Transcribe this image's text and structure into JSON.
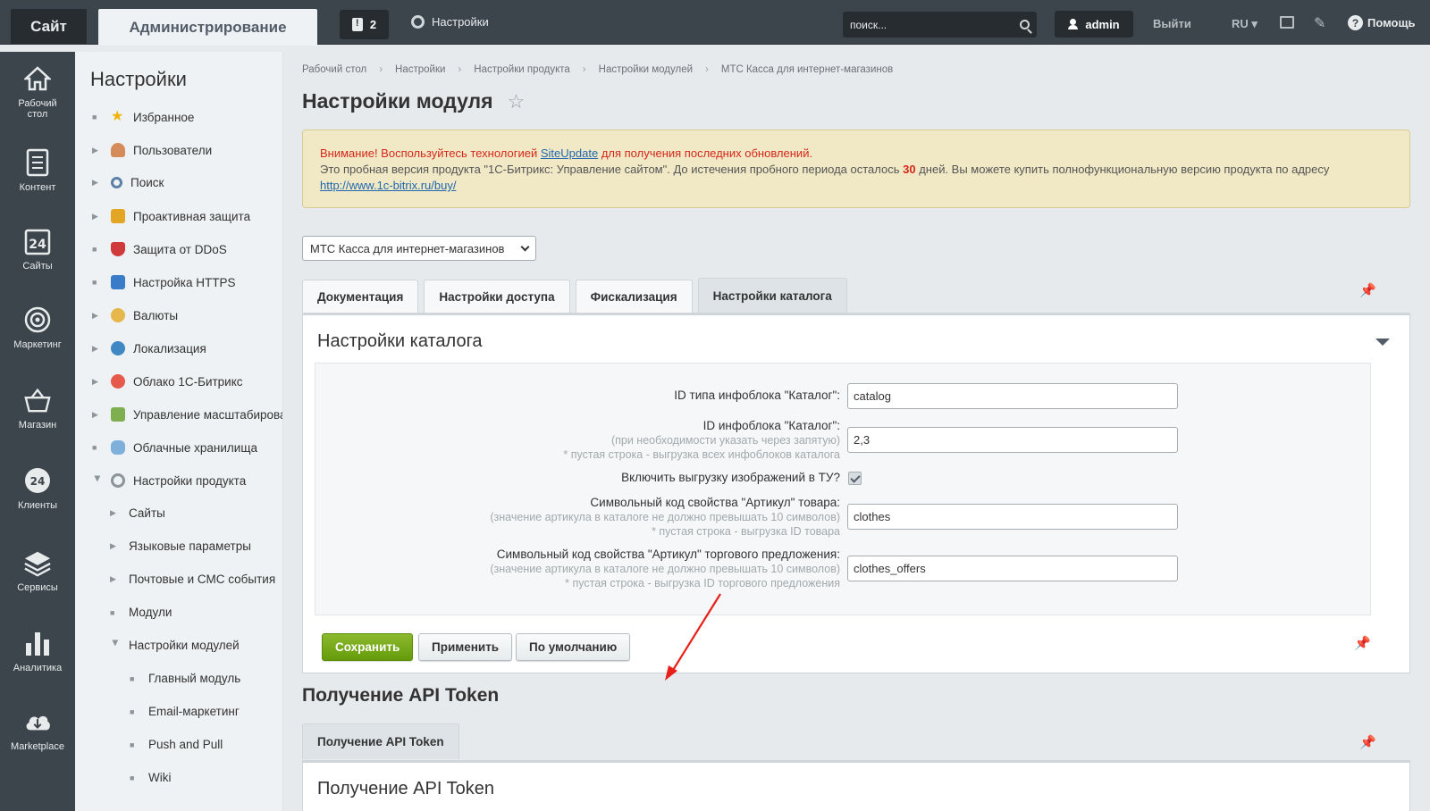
{
  "topbar": {
    "site_tab": "Сайт",
    "admin_tab": "Администрирование",
    "notifications_count": "2",
    "settings_label": "Настройки",
    "search_placeholder": "поиск...",
    "user": "admin",
    "logout": "Выйти",
    "lang": "RU",
    "help": "Помощь"
  },
  "leftmenu": {
    "items": [
      {
        "label": "Рабочий стол",
        "icon": "home-icon"
      },
      {
        "label": "Контент",
        "icon": "document-icon"
      },
      {
        "label": "Сайты",
        "icon": "calendar-24-icon"
      },
      {
        "label": "Маркетинг",
        "icon": "target-icon"
      },
      {
        "label": "Магазин",
        "icon": "basket-icon"
      },
      {
        "label": "Клиенты",
        "icon": "clients-24-icon"
      },
      {
        "label": "Сервисы",
        "icon": "layers-icon"
      },
      {
        "label": "Аналитика",
        "icon": "chart-icon"
      },
      {
        "label": "Marketplace",
        "icon": "cloud-download-icon"
      }
    ]
  },
  "sidebar": {
    "title": "Настройки",
    "items": [
      {
        "label": "Избранное"
      },
      {
        "label": "Пользователи"
      },
      {
        "label": "Поиск"
      },
      {
        "label": "Проактивная защита"
      },
      {
        "label": "Защита от DDoS"
      },
      {
        "label": "Настройка HTTPS"
      },
      {
        "label": "Валюты"
      },
      {
        "label": "Локализация"
      },
      {
        "label": "Облако 1С-Битрикс"
      },
      {
        "label": "Управление масштабирова"
      },
      {
        "label": "Облачные хранилища"
      },
      {
        "label": "Настройки продукта"
      },
      {
        "label": "Сайты"
      },
      {
        "label": "Языковые параметры"
      },
      {
        "label": "Почтовые и СМС события"
      },
      {
        "label": "Модули"
      },
      {
        "label": "Настройки модулей"
      },
      {
        "label": "Главный модуль"
      },
      {
        "label": "Email-маркетинг"
      },
      {
        "label": "Push and Pull"
      },
      {
        "label": "Wiki"
      }
    ]
  },
  "breadcrumbs": [
    "Рабочий стол",
    "Настройки",
    "Настройки продукта",
    "Настройки модулей",
    "МТС Касса для интернет-магазинов"
  ],
  "page_title": "Настройки модуля",
  "warning": {
    "line1_prefix": "Внимание! Воспользуйтесь технологией ",
    "line1_link": "SiteUpdate",
    "line1_suffix": " для получения последних обновлений.",
    "line2_prefix": "Это пробная версия продукта \"1С-Битрикс: Управление сайтом\". До истечения пробного периода осталось ",
    "days": "30",
    "line2_suffix": " дней. Вы можете купить полнофункциональную версию продукта по адресу ",
    "buy_link": "http://www.1c-bitrix.ru/buy/"
  },
  "module_select": "МТС Касса для интернет-магазинов",
  "tabs": [
    "Документация",
    "Настройки доступа",
    "Фискализация",
    "Настройки каталога"
  ],
  "active_tab": "Настройки каталога",
  "panel_title": "Настройки каталога",
  "form": {
    "iblock_type_label": "ID типа инфоблока \"Каталог\":",
    "iblock_type_value": "catalog",
    "iblock_id_label": "ID инфоблока \"Каталог\":",
    "iblock_id_hint1": "(при необходимости указать через запятую)",
    "iblock_id_hint2": "* пустая строка - выгрузка всех инфоблоков каталога",
    "iblock_id_value": "2,3",
    "images_label": "Включить выгрузку изображений в ТУ?",
    "images_checked": true,
    "sku_label": "Символьный код свойства \"Артикул\" товара:",
    "sku_hint1": "(значение артикула в каталоге не должно превышать 10 символов)",
    "sku_hint2": "* пустая строка - выгрузка ID товара",
    "sku_value": "clothes",
    "offer_sku_label": "Символьный код свойства \"Артикул\" торгового предложения:",
    "offer_sku_hint1": "(значение артикула в каталоге не должно превышать 10 символов)",
    "offer_sku_hint2": "* пустая строка - выгрузка ID торгового предложения",
    "offer_sku_value": "clothes_offers"
  },
  "buttons": {
    "save": "Сохранить",
    "apply": "Применить",
    "default": "По умолчанию"
  },
  "api": {
    "section_title": "Получение API Token",
    "tab": "Получение API Token",
    "panel_title": "Получение API Token"
  },
  "colors": {
    "save_green": "#649b0a",
    "arrow_red": "#e8201a",
    "warning_red": "#d4271b",
    "dark_bar": "#3c454c"
  }
}
